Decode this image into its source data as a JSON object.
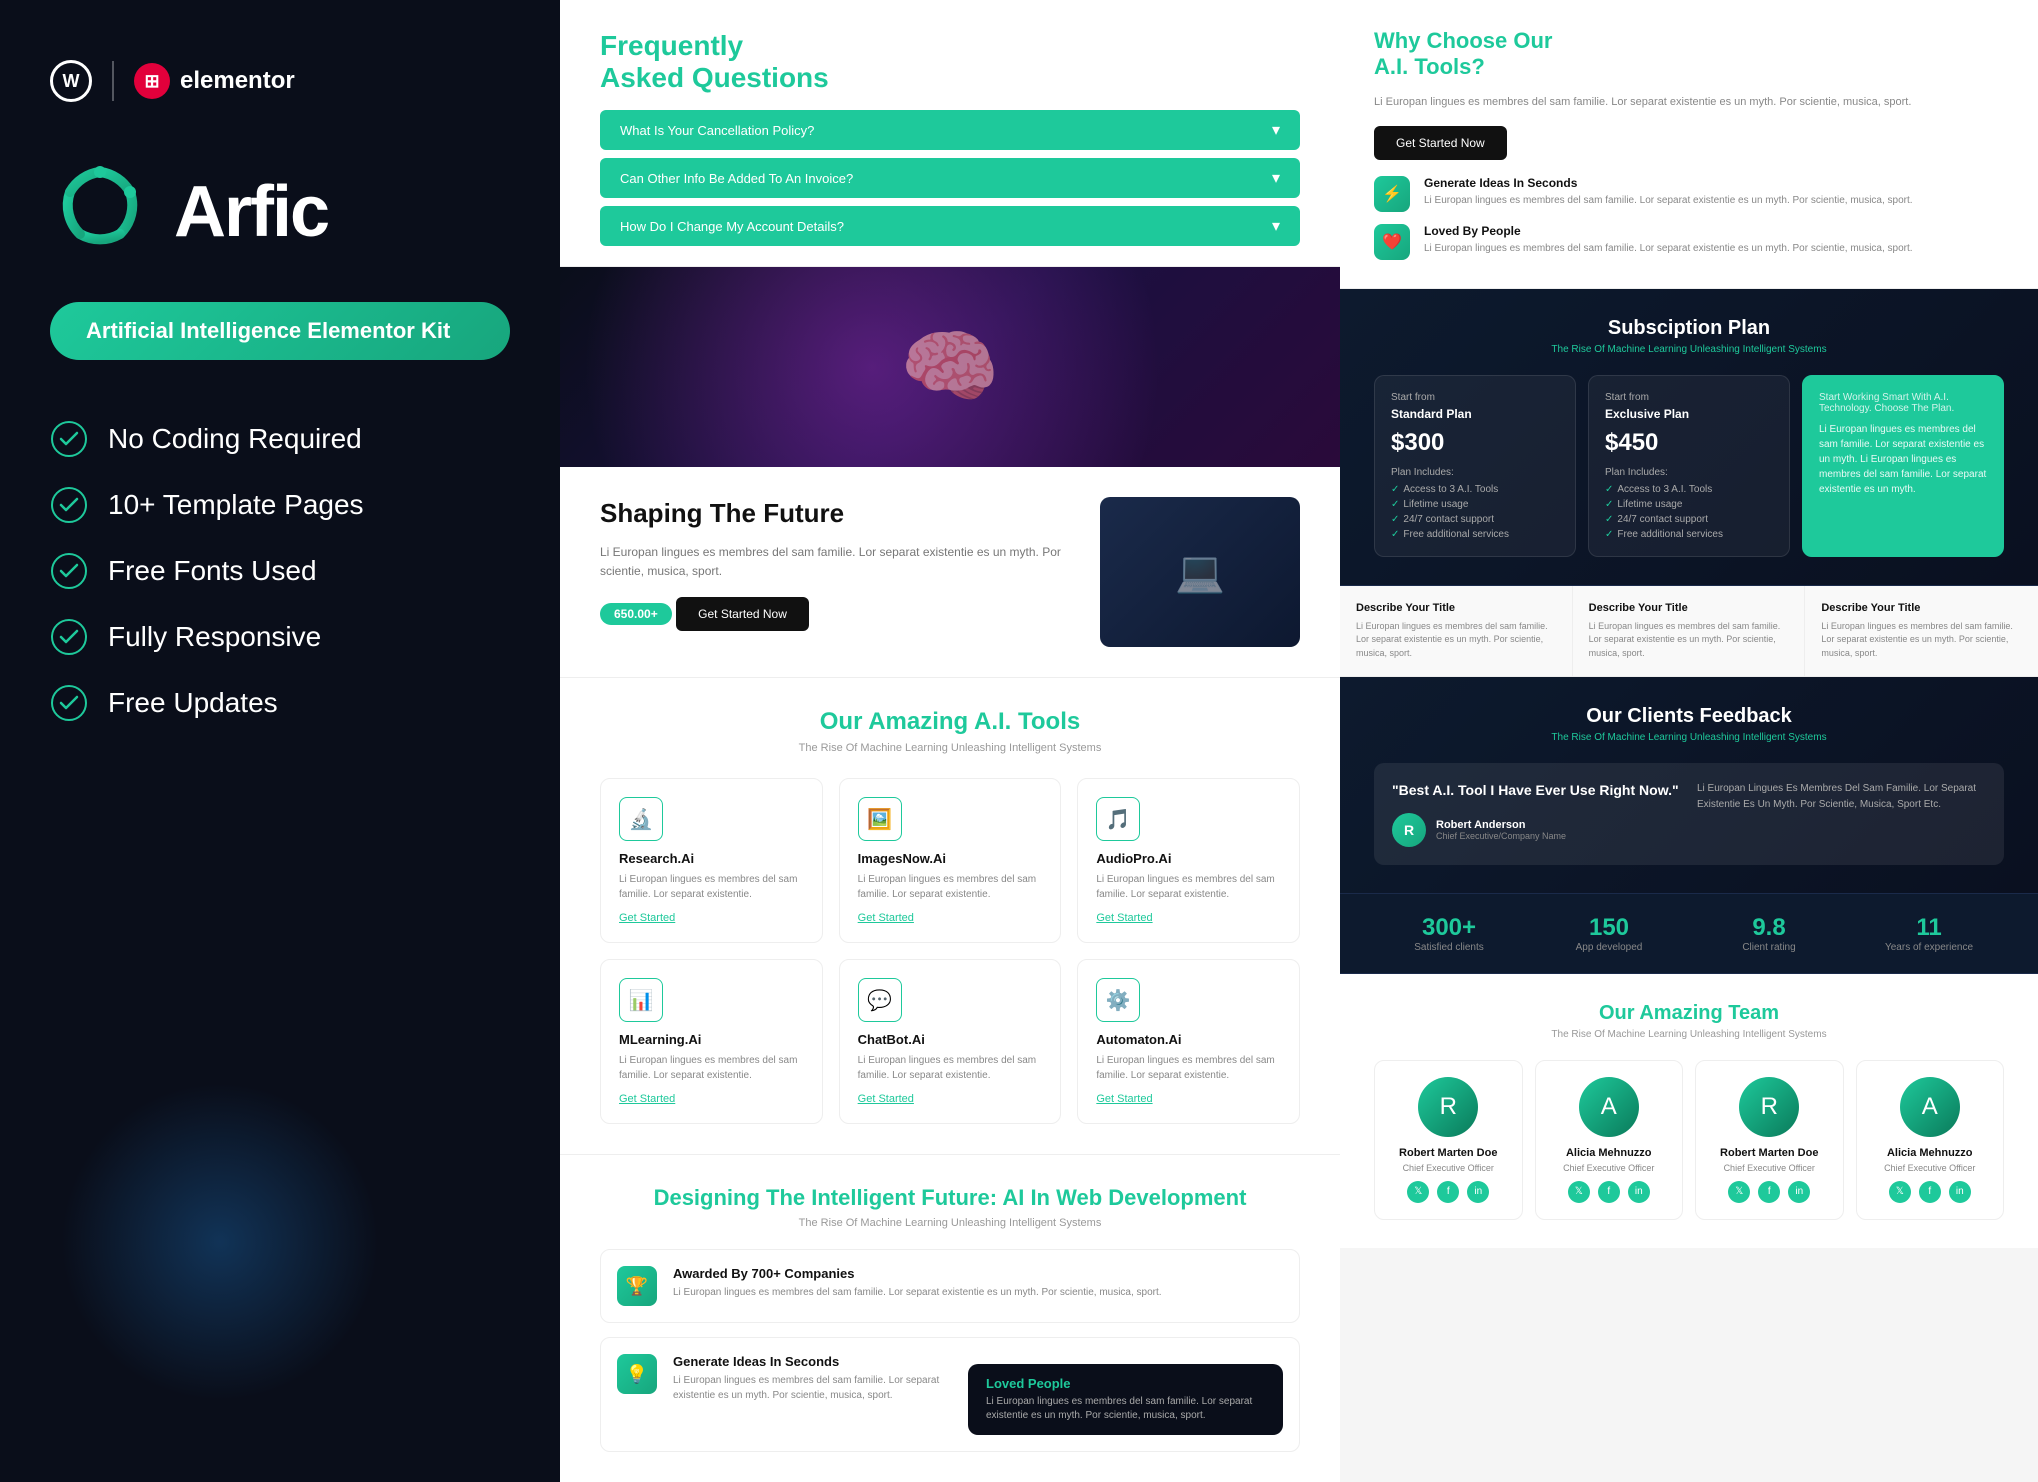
{
  "left": {
    "wordpress_label": "W",
    "elementor_label": "elementor",
    "logo_name": "Arfic",
    "tagline": "Artificial Intelligence Elementor Kit",
    "features": [
      {
        "id": "no-coding",
        "label": "No Coding Required"
      },
      {
        "id": "templates",
        "label": "10+ Template Pages"
      },
      {
        "id": "fonts",
        "label": "Free Fonts Used"
      },
      {
        "id": "responsive",
        "label": "Fully Responsive"
      },
      {
        "id": "updates",
        "label": "Free Updates"
      }
    ]
  },
  "middle": {
    "faq": {
      "title_prefix": "Frequently",
      "title_highlight": "Asked Questions",
      "items": [
        "What Is Your Cancellation Policy?",
        "Can Other Info Be Added To An Invoice?",
        "How Do I Change My Account Details?"
      ]
    },
    "shaping": {
      "title": "Shaping The Future",
      "desc": "Li Europan lingues es membres del sam familie. Lor separat existentie es un myth. Por scientie, musica, sport.",
      "stat": "650.00+",
      "btn": "Get Started Now"
    },
    "ai_tools": {
      "title_prefix": "Our Amazing",
      "title_highlight": "A.I. Tools",
      "subtitle": "The Rise Of Machine Learning Unleashing Intelligent Systems",
      "tools": [
        {
          "icon": "🔬",
          "name": "Research.Ai",
          "desc": "Li Europan lingues es membres del sam familie. Lor separat existentie.",
          "link": "Get Started"
        },
        {
          "icon": "🖼️",
          "name": "ImagesNow.Ai",
          "desc": "Li Europan lingues es membres del sam familie. Lor separat existentie.",
          "link": "Get Started"
        },
        {
          "icon": "🎵",
          "name": "AudioPro.Ai",
          "desc": "Li Europan lingues es membres del sam familie. Lor separat existentie.",
          "link": "Get Started"
        },
        {
          "icon": "📊",
          "name": "MLearning.Ai",
          "desc": "Li Europan lingues es membres del sam familie. Lor separat existentie.",
          "link": "Get Started"
        },
        {
          "icon": "💬",
          "name": "ChatBot.Ai",
          "desc": "Li Europan lingues es membres del sam familie. Lor separat existentie.",
          "link": "Get Started"
        },
        {
          "icon": "⚙️",
          "name": "Automaton.Ai",
          "desc": "Li Europan lingues es membres del sam familie. Lor separat existentie.",
          "link": "Get Started"
        }
      ]
    },
    "designing": {
      "title_prefix": "Designing The Intelligent Future:",
      "title_highlight": "AI In Web Development",
      "subtitle": "The Rise Of Machine Learning Unleashing Intelligent Systems",
      "cards": [
        {
          "icon": "🏆",
          "name": "Awarded By 700+ Companies",
          "desc": "Li Europan lingues es membres del sam familie. Lor separat existentie es un myth. Por scientie, musica, sport."
        },
        {
          "icon": "💡",
          "name": "Generate Ideas In Seconds",
          "desc": "Li Europan lingues es membres del sam familie. Lor separat existentie es un myth. Por scientie, musica, sport."
        }
      ],
      "loved_badge": {
        "title": "Loved People",
        "desc": "Li Europan lingues es membres del sam familie. Lor separat existentie es un myth. Por scientie, musica, sport."
      }
    }
  },
  "right": {
    "why_choose": {
      "title_prefix": "Why Choose Our",
      "title_highlight": "A.I. Tools?",
      "desc": "Li Europan lingues es membres del sam familie. Lor separat existentie es un myth. Por scientie, musica, sport.",
      "btn": "Get Started Now",
      "items": [
        {
          "icon": "⚡",
          "name": "Generate Ideas In Seconds",
          "desc": "Li Europan lingues es membres del sam familie. Lor separat existentie es un myth. Por scientie, musica, sport."
        },
        {
          "icon": "❤️",
          "name": "Loved By People",
          "desc": "Li Europan lingues es membres del sam familie. Lor separat existentie es un myth. Por scientie, musica, sport."
        }
      ]
    },
    "subscription": {
      "title": "Subsciption Plan",
      "subtitle": "The Rise Of Machine Learning Unleashing Intelligent Systems",
      "plans": [
        {
          "label": "Start from",
          "name": "Standard Plan",
          "price": "$300",
          "includes_label": "Plan Includes:",
          "features": [
            "Access to 3 A.I. Tools",
            "Lifetime usage",
            "24/7 contact support",
            "Free additional services"
          ],
          "featured": false
        },
        {
          "label": "Start from",
          "name": "Exclusive Plan",
          "price": "$450",
          "includes_label": "Plan Includes:",
          "features": [
            "Access to 3 A.I. Tools",
            "Lifetime usage",
            "24/7 contact support",
            "Free additional services"
          ],
          "featured": false
        },
        {
          "label": "Start Working Smart With A.I. Technology. Choose The Plan.",
          "name": "",
          "price": "",
          "includes_label": "",
          "features": [],
          "featured": true,
          "desc": "Li Europan lingues es membres del sam familie. Lor separat existentie es un myth. Li Europan lingues es membres del sam familie. Lor separat existentie es un myth."
        }
      ]
    },
    "describe": {
      "items": [
        {
          "title": "Describe Your Title",
          "desc": "Li Europan lingues es membres del sam familie. Lor separat existentie es un myth. Por scientie, musica, sport."
        },
        {
          "title": "Describe Your Title",
          "desc": "Li Europan lingues es membres del sam familie. Lor separat existentie es un myth. Por scientie, musica, sport."
        },
        {
          "title": "Describe Your Title",
          "desc": "Li Europan lingues es membres del sam familie. Lor separat existentie es un myth. Por scientie, musica, sport."
        }
      ]
    },
    "feedback": {
      "title": "Our Clients Feedback",
      "subtitle": "The Rise Of Machine Learning Unleashing Intelligent Systems",
      "left_quote": "\"Best A.I. Tool I Have Ever Use Right Now.\"",
      "right_body": "Li Europan Lingues Es Membres Del Sam Familie. Lor Separat Existentie Es Un Myth. Por Scientie, Musica, Sport Etc.",
      "author_name": "Robert Anderson",
      "author_role": "Chief Executive/Company Name"
    },
    "stats": [
      {
        "value": "300+",
        "label": "Satisfied clients"
      },
      {
        "value": "150",
        "label": "App developed"
      },
      {
        "value": "9.8",
        "label": "Client rating"
      },
      {
        "value": "11",
        "label": "Years of experience"
      }
    ],
    "team": {
      "title_prefix": "Our Amazing",
      "title_highlight": "Team",
      "subtitle": "The Rise Of Machine Learning Unleashing Intelligent Systems",
      "members": [
        {
          "name": "Robert Marten Doe",
          "role": "Chief Executive Officer",
          "avatar": "R"
        },
        {
          "name": "Alicia Mehnuzzo",
          "role": "Chief Executive Officer",
          "avatar": "A"
        },
        {
          "name": "Robert Marten Doe",
          "role": "Chief Executive Officer",
          "avatar": "R"
        },
        {
          "name": "Alicia Mehnuzzo",
          "role": "Chief Executive Officer",
          "avatar": "A"
        }
      ]
    }
  }
}
